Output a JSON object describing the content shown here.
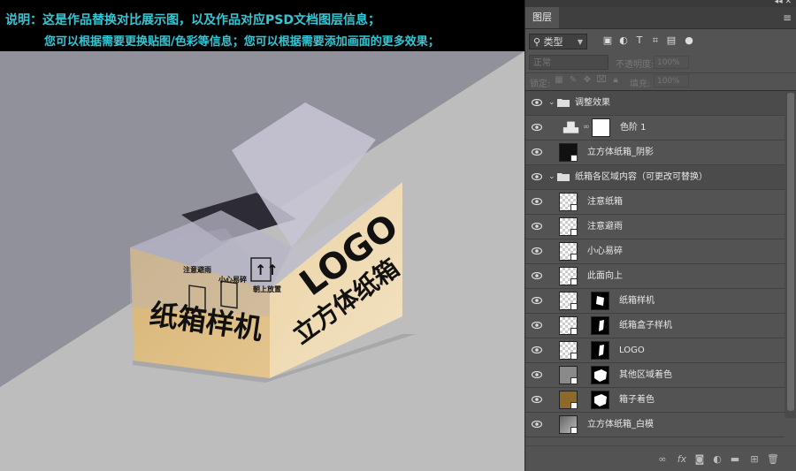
{
  "banner": {
    "line1": "说明：这是作品替换对比展示图，以及作品对应PSD文档图层信息；",
    "line2": "您可以根据需要更换贴图/色彩等信息；您可以根据需要添加画面的更多效果；"
  },
  "mockup": {
    "left_face_title": "纸箱样机",
    "right_face_logo": "LOGO",
    "right_face_title": "立方体纸箱",
    "icon_labels": [
      "注意避雨",
      "小心易碎",
      "朝上放置"
    ],
    "box_color": "#d9b576"
  },
  "panel": {
    "window_controls": "◂◂ ✕",
    "tab_label": "图层",
    "filter_label": "类型",
    "blend_mode": "正常",
    "opacity_label": "不透明度:",
    "opacity_value": "100%",
    "lock_label": "锁定:",
    "fill_label": "填充:",
    "fill_value": "100%"
  },
  "layers": [
    {
      "name": "调整效果",
      "type": "group"
    },
    {
      "name": "色阶 1",
      "type": "adjustment"
    },
    {
      "name": "立方体纸箱_阴影",
      "type": "smart-dark"
    },
    {
      "name": "纸箱各区域内容（可更改可替换）",
      "type": "group"
    },
    {
      "name": "注意纸箱",
      "type": "smart"
    },
    {
      "name": "注意避雨",
      "type": "smart"
    },
    {
      "name": "小心易碎",
      "type": "smart"
    },
    {
      "name": "此面向上",
      "type": "smart"
    },
    {
      "name": "纸箱样机",
      "type": "smart-mask"
    },
    {
      "name": "纸箱盒子样机",
      "type": "smart-mask"
    },
    {
      "name": "LOGO",
      "type": "smart-mask"
    },
    {
      "name": "其他区域着色",
      "type": "gray-mask"
    },
    {
      "name": "箱子着色",
      "type": "brown-mask"
    },
    {
      "name": "立方体纸箱_白模",
      "type": "smart-gray"
    }
  ]
}
